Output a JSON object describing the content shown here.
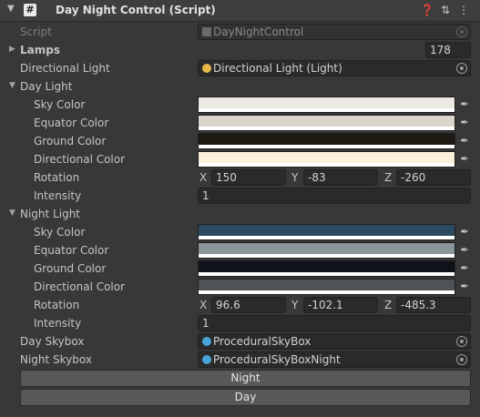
{
  "header": {
    "title": "Day Night Control (Script)",
    "icons": [
      "fold-arrow",
      "script-icon",
      "help-icon",
      "preset-icon",
      "context-menu-icon"
    ]
  },
  "script": {
    "label": "Script",
    "value": "DayNightControl"
  },
  "lamps": {
    "label": "Lamps",
    "value": "178"
  },
  "directional_light": {
    "label": "Directional Light",
    "value": "Directional Light (Light)"
  },
  "day_light": {
    "label": "Day Light",
    "sky_color": {
      "label": "Sky Color",
      "color": "#ece9e2"
    },
    "equator_color": {
      "label": "Equator Color",
      "color": "#d9d5cb"
    },
    "ground_color": {
      "label": "Ground Color",
      "color": "#1f1a13"
    },
    "directional_color": {
      "label": "Directional Color",
      "color": "#fcf2dc"
    },
    "rotation": {
      "label": "Rotation",
      "x": "150",
      "y": "-83",
      "z": "-260"
    },
    "intensity": {
      "label": "Intensity",
      "value": "1"
    }
  },
  "night_light": {
    "label": "Night Light",
    "sky_color": {
      "label": "Sky Color",
      "color": "#2b4b60"
    },
    "equator_color": {
      "label": "Equator Color",
      "color": "#8b969b"
    },
    "ground_color": {
      "label": "Ground Color",
      "color": "#0d1319"
    },
    "directional_color": {
      "label": "Directional Color",
      "color": "#4f5358"
    },
    "rotation": {
      "label": "Rotation",
      "x": "96.6",
      "y": "-102.1",
      "z": "-485.3"
    },
    "intensity": {
      "label": "Intensity",
      "value": "1"
    }
  },
  "axes": {
    "x": "X",
    "y": "Y",
    "z": "Z"
  },
  "day_skybox": {
    "label": "Day Skybox",
    "value": "ProceduralSkyBox"
  },
  "night_skybox": {
    "label": "Night Skybox",
    "value": "ProceduralSkyBoxNight"
  },
  "buttons": {
    "night": "Night",
    "day": "Day"
  }
}
